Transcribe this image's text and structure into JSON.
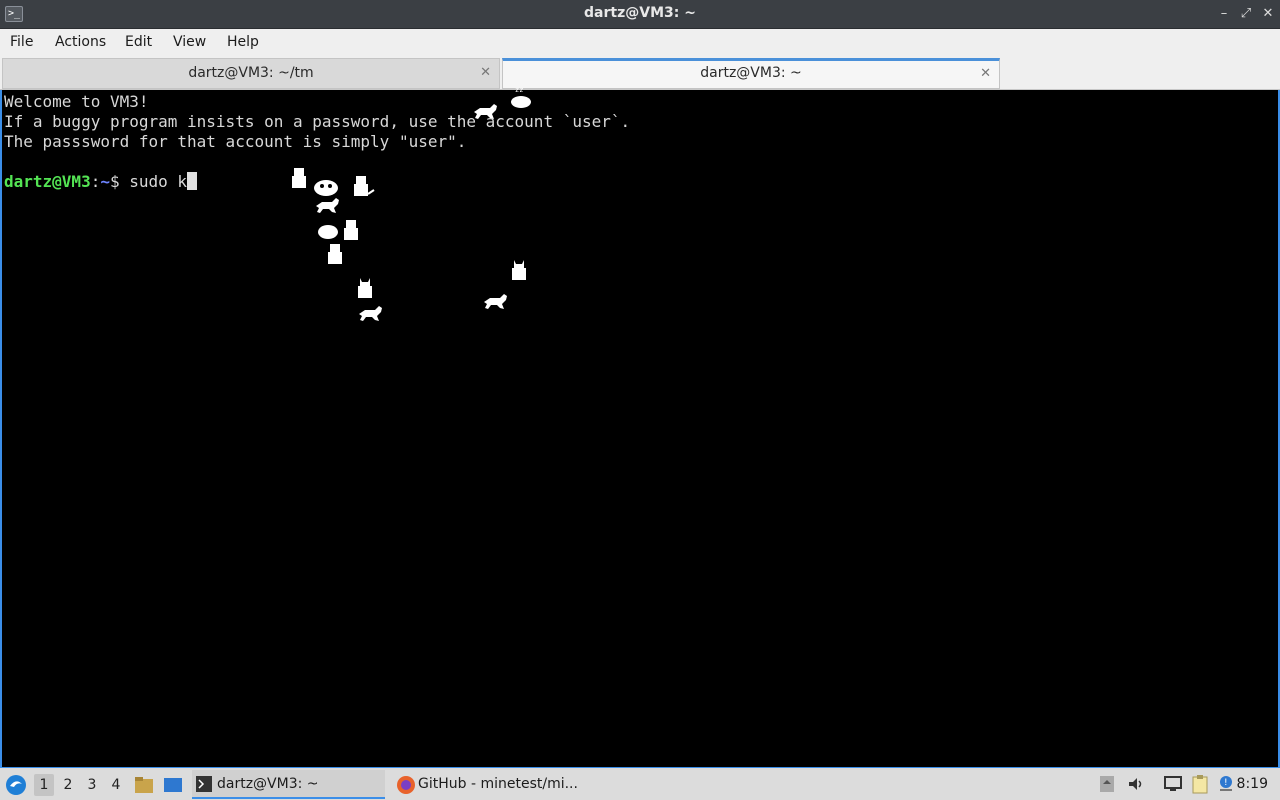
{
  "window": {
    "title": "dartz@VM3: ~",
    "icon": "terminal-icon",
    "minimize": "–",
    "maximize": "⤢",
    "close": "✕"
  },
  "menu": [
    "File",
    "Actions",
    "Edit",
    "View",
    "Help"
  ],
  "tabs": [
    {
      "label": "dartz@VM3: ~/tm",
      "close": "✕",
      "active": false
    },
    {
      "label": "dartz@VM3: ~",
      "close": "✕",
      "active": true
    }
  ],
  "terminal": {
    "lines": [
      "Welcome to VM3!",
      "If a buggy program insists on a password, use the account `user`.",
      "The passsword for that account is simply \"user\"."
    ],
    "prompt_user": "dartz@VM3",
    "prompt_sep": ":",
    "prompt_path": "~",
    "prompt_symbol": "$ ",
    "command": "sudo k",
    "background": "#000000",
    "text_color": "#d8d8d8",
    "user_color": "#54e454",
    "path_color": "#6d84ff"
  },
  "taskbar": {
    "start_icon": "lubuntu-menu-icon",
    "desktops": [
      "1",
      "2",
      "3",
      "4"
    ],
    "current_desktop": "1",
    "tasks": [
      {
        "label": "dartz@VM3: ~",
        "icon": "terminal-icon",
        "active": true
      },
      {
        "label": "GitHub - minetest/mi...",
        "icon": "firefox-icon",
        "active": false
      }
    ],
    "clock": "8:19",
    "accent": "#3b8ee8"
  }
}
